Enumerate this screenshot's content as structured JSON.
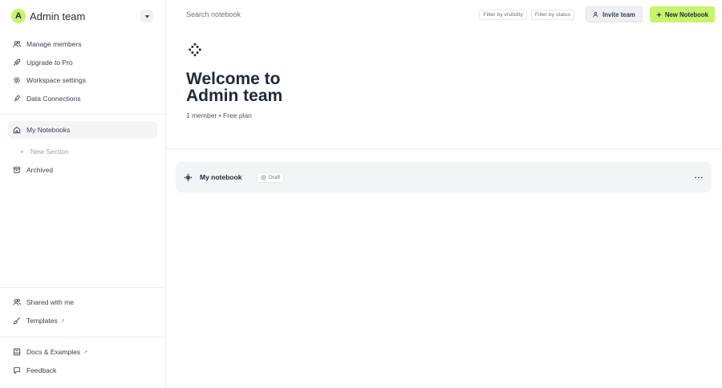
{
  "workspace": {
    "avatar_letter": "A",
    "name": "Admin team"
  },
  "sidebar": {
    "top_items": [
      {
        "label": "Manage members",
        "icon": "users-icon"
      },
      {
        "label": "Upgrade to Pro",
        "icon": "rocket-icon"
      },
      {
        "label": "Workspace settings",
        "icon": "gear-icon"
      },
      {
        "label": "Data Connections",
        "icon": "plug-icon"
      }
    ],
    "my_notebooks": "My Notebooks",
    "new_section": "New Section",
    "archived": "Archived",
    "shared_with_me": "Shared with me",
    "templates": "Templates",
    "docs_examples": "Docs & Examples",
    "feedback": "Feedback",
    "external_mark": "↗"
  },
  "topbar": {
    "search_placeholder": "Search notebook",
    "filter_visibility": "Filter by visibility",
    "filter_status": "Filter by status",
    "invite_label": "Invite team",
    "new_notebook_label": "New Notebook"
  },
  "hero": {
    "title": "Welcome to Admin team",
    "members": "1 member",
    "separator": "•",
    "plan": "Free plan"
  },
  "notebooks": [
    {
      "title": "My notebook",
      "status": "Draft"
    }
  ],
  "colors": {
    "accent": "#c6f56b",
    "row_bg": "#f3f4f6"
  }
}
